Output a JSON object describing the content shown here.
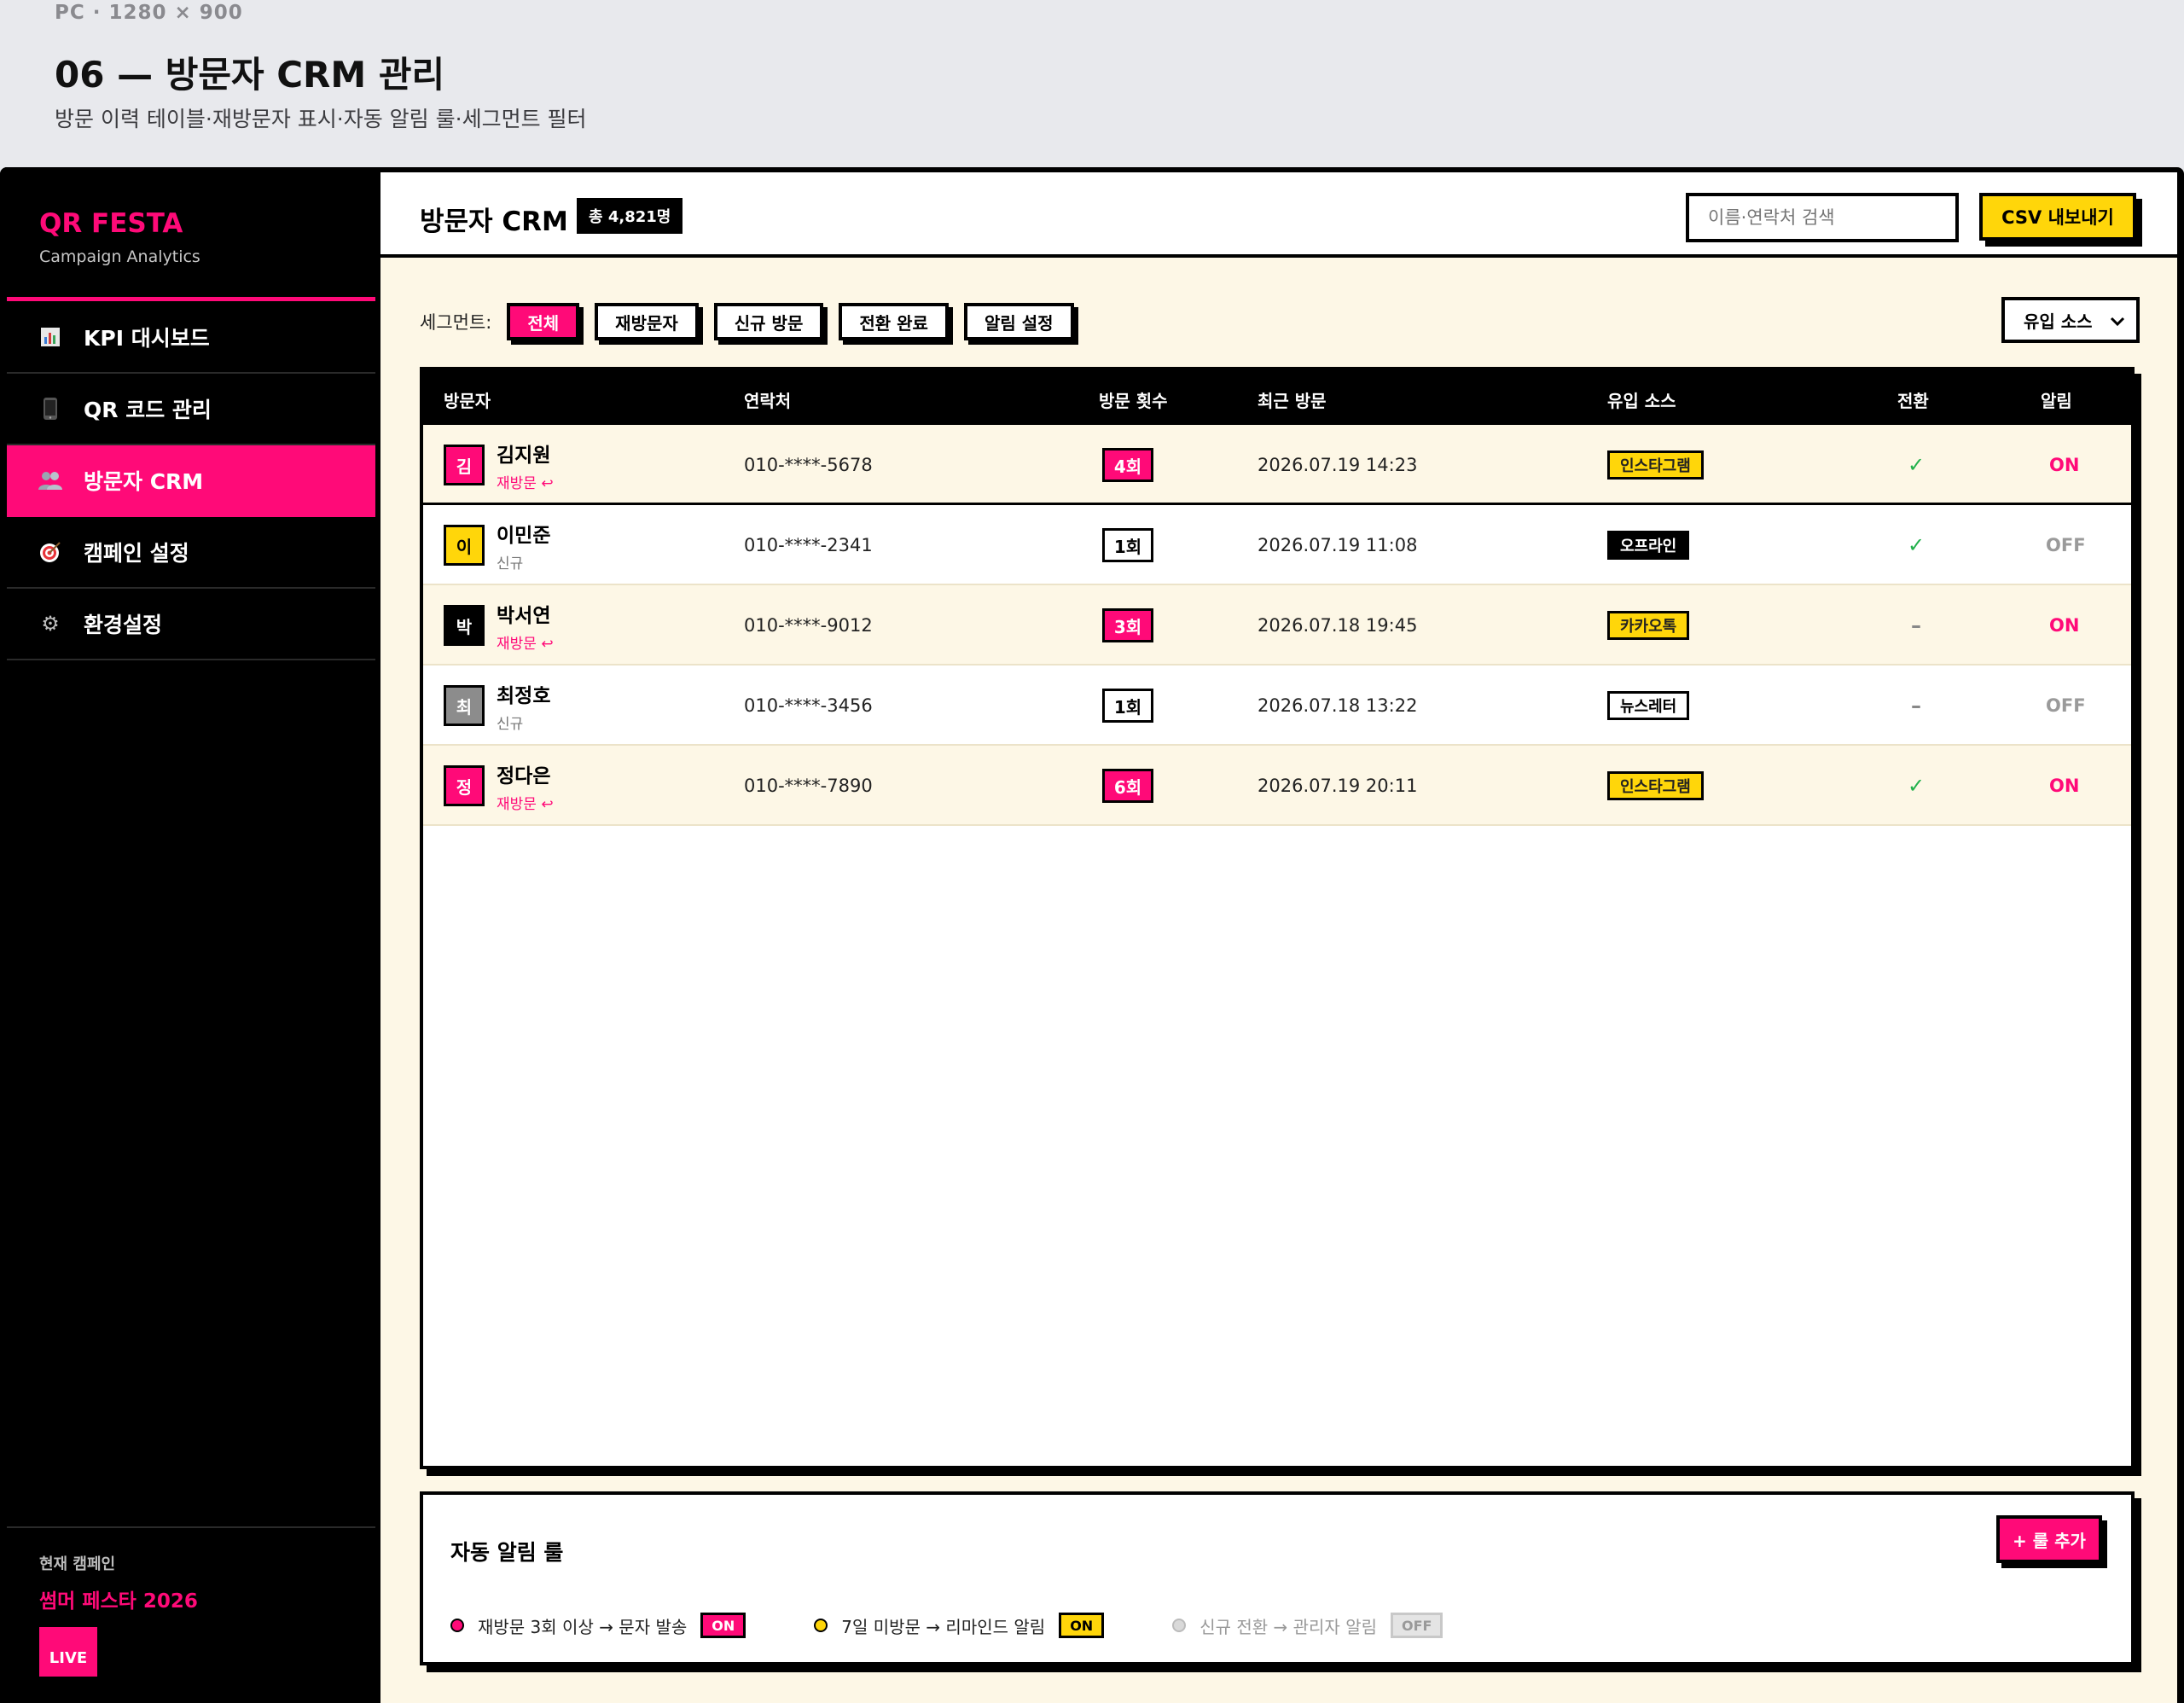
{
  "page": {
    "caption": "PC · 1280 × 900",
    "title": "06 — 방문자 CRM 관리",
    "subtitle": "방문 이력 테이블·재방문자 표시·자동 알림 룰·세그먼트 필터"
  },
  "sidebar": {
    "brand": "QR FESTA",
    "brand_sub": "Campaign Analytics",
    "items": [
      {
        "label": "KPI 대시보드",
        "icon": "bar-chart-icon"
      },
      {
        "label": "QR 코드 관리",
        "icon": "phone-icon"
      },
      {
        "label": "방문자 CRM",
        "icon": "users-icon",
        "active": true
      },
      {
        "label": "캠페인 설정",
        "icon": "target-icon"
      },
      {
        "label": "환경설정",
        "icon": "gear-icon"
      }
    ],
    "footer": {
      "label": "현재 캠페인",
      "campaign": "썸머 페스타 2026",
      "live": "LIVE"
    }
  },
  "topbar": {
    "title": "방문자 CRM",
    "total": "총 4,821명",
    "search_placeholder": "이름·연락처 검색",
    "csv_label": "CSV 내보내기"
  },
  "segments": {
    "label": "세그먼트:",
    "chips": [
      "전체",
      "재방문자",
      "신규 방문",
      "전환 완료",
      "알림 설정"
    ],
    "source_select": "유입 소스"
  },
  "table": {
    "headers": [
      "방문자",
      "연락처",
      "방문 횟수",
      "최근 방문",
      "유입 소스",
      "전환",
      "알림"
    ],
    "rows": [
      {
        "initial": "김",
        "name": "김지원",
        "tag": "재방문 ↩",
        "phone": "010-****-5678",
        "visits": "4회",
        "last": "2026.07.19 14:23",
        "source": "인스타그램",
        "conv": "✓",
        "alert": "ON"
      },
      {
        "initial": "이",
        "name": "이민준",
        "tag": "신규",
        "phone": "010-****-2341",
        "visits": "1회",
        "last": "2026.07.19 11:08",
        "source": "오프라인",
        "conv": "✓",
        "alert": "OFF"
      },
      {
        "initial": "박",
        "name": "박서연",
        "tag": "재방문 ↩",
        "phone": "010-****-9012",
        "visits": "3회",
        "last": "2026.07.18 19:45",
        "source": "카카오톡",
        "conv": "–",
        "alert": "ON"
      },
      {
        "initial": "최",
        "name": "최정호",
        "tag": "신규",
        "phone": "010-****-3456",
        "visits": "1회",
        "last": "2026.07.18 13:22",
        "source": "뉴스레터",
        "conv": "–",
        "alert": "OFF"
      },
      {
        "initial": "정",
        "name": "정다은",
        "tag": "재방문 ↩",
        "phone": "010-****-7890",
        "visits": "6회",
        "last": "2026.07.19 20:11",
        "source": "인스타그램",
        "conv": "✓",
        "alert": "ON"
      }
    ]
  },
  "rules": {
    "title": "자동 알림 룰",
    "add_label": "+ 룰 추가",
    "items": [
      {
        "text": "재방문 3회 이상 → 문자 발송",
        "state": "ON",
        "color": "#ff0a78"
      },
      {
        "text": "7일 미방문 → 리마인드 알림",
        "state": "ON",
        "color": "#ffd60a"
      },
      {
        "text": "신규 전환 → 관리자 알림",
        "state": "OFF",
        "color": "#d9d9d9"
      }
    ]
  },
  "colors": {
    "accent": "#ff0a78",
    "yellow": "#ffd60a",
    "success": "#22b14c",
    "cream": "#fdf7e6"
  }
}
